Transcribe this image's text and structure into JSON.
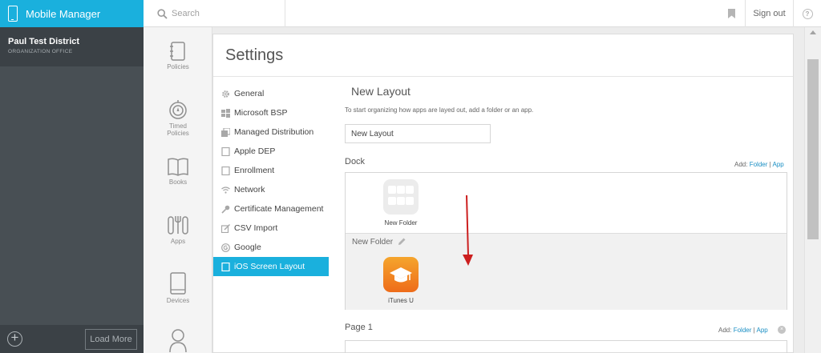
{
  "app": {
    "title": "Mobile Manager"
  },
  "search": {
    "placeholder": "Search"
  },
  "header": {
    "signout_label": "Sign out",
    "help_label": "?"
  },
  "org": {
    "name": "Paul Test District",
    "subtitle": "ORGANIZATION OFFICE"
  },
  "sidebar_footer": {
    "load_more_label": "Load More",
    "add_label": "+"
  },
  "rail": {
    "policies": "Policies",
    "timed_line1": "Timed",
    "timed_line2": "Policies",
    "books": "Books",
    "apps": "Apps",
    "devices": "Devices"
  },
  "settings": {
    "title": "Settings",
    "menu": [
      {
        "label": "General",
        "icon": "gear-icon"
      },
      {
        "label": "Microsoft BSP",
        "icon": "windows-icon"
      },
      {
        "label": "Managed Distribution",
        "icon": "distribution-icon"
      },
      {
        "label": "Apple DEP",
        "icon": "device-icon"
      },
      {
        "label": "Enrollment",
        "icon": "device-icon"
      },
      {
        "label": "Network",
        "icon": "wifi-icon"
      },
      {
        "label": "Certificate Management",
        "icon": "key-icon"
      },
      {
        "label": "CSV Import",
        "icon": "import-icon"
      },
      {
        "label": "Google",
        "icon": "google-icon"
      },
      {
        "label": "iOS Screen Layout",
        "icon": "tablet-icon",
        "active": true
      }
    ]
  },
  "layout": {
    "title": "New Layout",
    "hint": "To start organizing how apps are layed out, add a folder or an app.",
    "name_value": "New Layout",
    "dock_label": "Dock",
    "add_prefix": "Add:",
    "add_folder": "Folder",
    "add_separator": "|",
    "add_app": "App",
    "folder_app_label": "New Folder",
    "folder_strip_label": "New Folder",
    "itunes_label": "iTunes U",
    "page1_label": "Page 1",
    "close_label": "×"
  },
  "colors": {
    "accent": "#1ab0dd",
    "sidebar": "#484f54",
    "arrow": "#cc1f1f",
    "itunes_orange": "#f08a23"
  }
}
